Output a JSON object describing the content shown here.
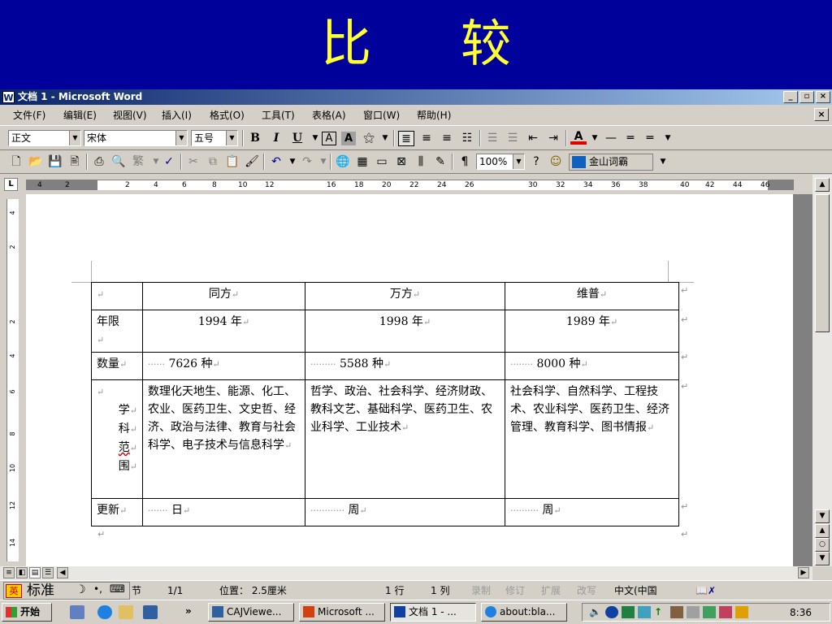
{
  "slide": {
    "title": "比较"
  },
  "window": {
    "title": "文档 1 - Microsoft Word",
    "app_icon": "W",
    "caption_buttons": [
      "_",
      "▫",
      "×"
    ],
    "doc_close": "×"
  },
  "menu": [
    "文件(F)",
    "编辑(E)",
    "视图(V)",
    "插入(I)",
    "格式(O)",
    "工具(T)",
    "表格(A)",
    "窗口(W)",
    "帮助(H)"
  ],
  "format_toolbar": {
    "style": "正文",
    "font": "宋体",
    "size": "五号",
    "bold": "B",
    "italic": "I",
    "underline": "U"
  },
  "standard_toolbar": {
    "zoom": "100%",
    "dictionary": "金山词霸"
  },
  "ruler": {
    "ticks": [
      "4",
      "2",
      "2",
      "4",
      "6",
      "8",
      "10",
      "12",
      "16",
      "18",
      "20",
      "22",
      "24",
      "26",
      "30",
      "32",
      "34",
      "36",
      "38",
      "40",
      "42",
      "44",
      "46"
    ]
  },
  "vruler": {
    "ticks": [
      "4",
      "2",
      "2",
      "4",
      "6",
      "8",
      "10",
      "12",
      "14"
    ]
  },
  "table": {
    "header": [
      "同方",
      "万方",
      "维普"
    ],
    "rows": [
      {
        "label": "年限",
        "cells": [
          "1994 年",
          "1998 年",
          "1989 年"
        ]
      },
      {
        "label": "数量",
        "cells": [
          "7626 种",
          "5588 种",
          "8000 种"
        ]
      },
      {
        "label": "学科范围",
        "label_chars": [
          "学",
          "科",
          "范",
          "围"
        ],
        "cells": [
          "数理化天地生、能源、化工、农业、医药卫生、文史哲、经济、政治与法律、教育与社会科学、电子技术与信息科学",
          "哲学、政治、社会科学、经济财政、教科文艺、基础科学、医药卫生、农业科学、工业技术",
          "社会科学、自然科学、工程技术、农业科学、医药卫生、经济管理、教育科学、图书情报"
        ]
      },
      {
        "label": "更新",
        "cells": [
          "日",
          "周",
          "周"
        ]
      }
    ],
    "mark": "↵"
  },
  "status": {
    "ime_label": "标准",
    "section": "节",
    "pages": "1/1",
    "position": "位置： 2.5厘米",
    "line": "1 行",
    "col": "1 列",
    "rec": "录制",
    "trk": "修订",
    "ext": "扩展",
    "ovr": "改写",
    "lang": "中文(中国"
  },
  "taskbar": {
    "start": "开始",
    "more": "»",
    "tasks": [
      "CAJViewe...",
      "Microsoft ...",
      "文档 1 - ...",
      "about:bla..."
    ],
    "clock": "8:36"
  },
  "colors": {
    "slide_bg": "#00009a",
    "slide_title": "#ffff33",
    "titlebar": "#0a246a",
    "chrome": "#d4d0c8"
  }
}
